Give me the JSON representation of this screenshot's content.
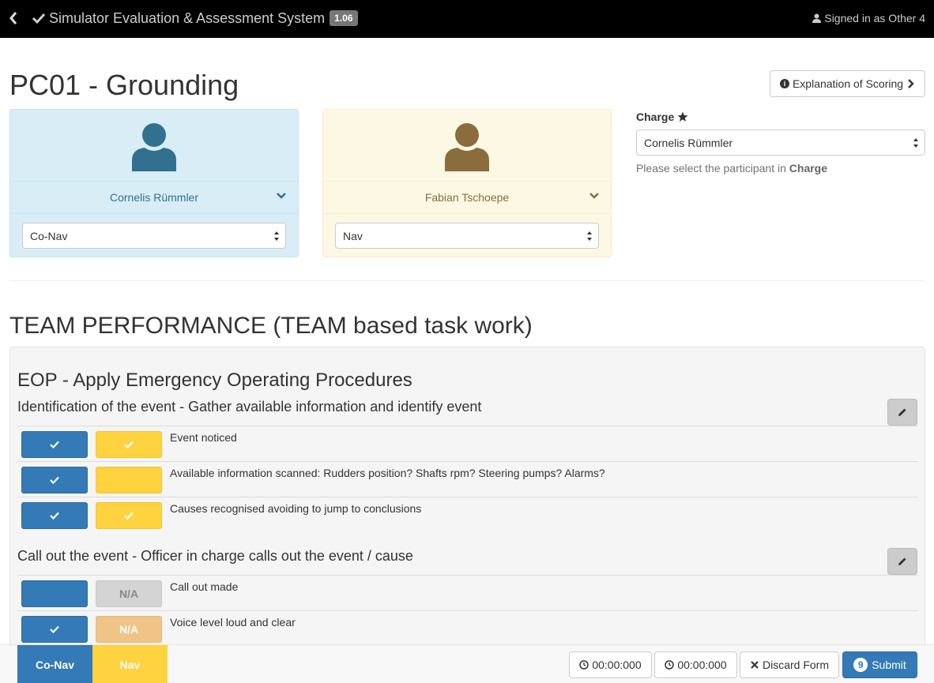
{
  "topbar": {
    "app_title": "Simulator Evaluation & Assessment System",
    "version": "1.06",
    "signed_in": "Signed in as Other 4"
  },
  "page": {
    "title": "PC01 - Grounding",
    "explain_button": "Explanation of Scoring"
  },
  "participants": [
    {
      "name": "Cornelis Rümmler",
      "role": "Co-Nav",
      "color": "#d9edf7"
    },
    {
      "name": "Fabian Tschoepe",
      "role": "Nav",
      "color": "#fcf8e3"
    }
  ],
  "charge": {
    "label": "Charge",
    "selected": "Cornelis Rümmler",
    "help_prefix": "Please select the participant in",
    "help_bold": "Charge"
  },
  "section": {
    "title": "TEAM PERFORMANCE (TEAM based task work)"
  },
  "group": {
    "title": "EOP - Apply Emergency Operating Procedures",
    "subsections": [
      {
        "title": "Identification of the event - Gather available information and identify event",
        "items": [
          {
            "label": "Event noticed",
            "a": "check",
            "b": "check"
          },
          {
            "label": "Available information scanned: Rudders position? Shafts rpm? Steering pumps? Alarms?",
            "a": "check",
            "b": "empty"
          },
          {
            "label": "Causes recognised avoiding to jump to conclusions",
            "a": "check",
            "b": "check"
          }
        ]
      },
      {
        "title": "Call out the event - Officer in charge calls out the event / cause",
        "items": [
          {
            "label": "Call out made",
            "a": "empty",
            "b": "N/A"
          },
          {
            "label": "Voice level loud and clear",
            "a": "check",
            "b": "N/A"
          }
        ]
      }
    ]
  },
  "footer": {
    "tab_conav": "Co-Nav",
    "tab_nav": "Nav",
    "timer1": "00:00:000",
    "timer2": "00:00:000",
    "discard": "Discard Form",
    "submit": "Submit",
    "submit_badge": "9"
  },
  "colors": {
    "primary": "#337ab7",
    "nav_yellow": "#ffd23f",
    "na_orange": "#f0c487"
  }
}
